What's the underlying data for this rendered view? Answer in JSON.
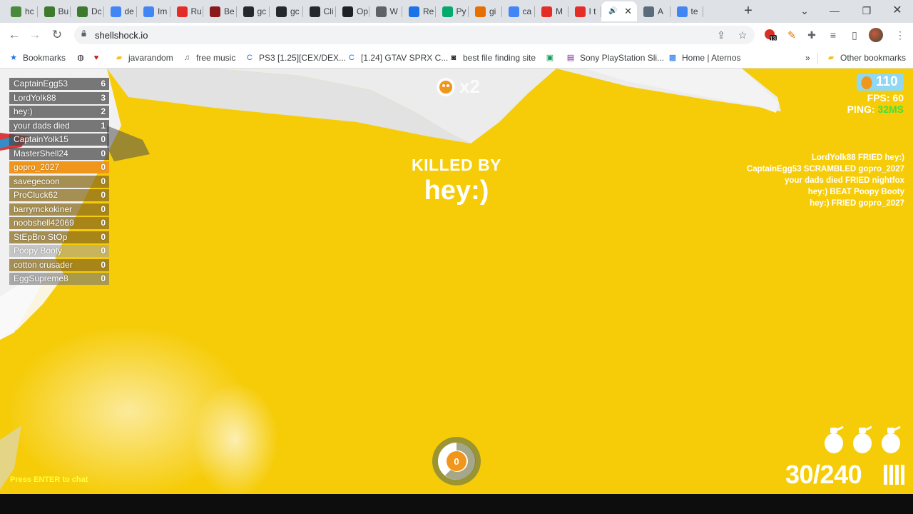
{
  "browser": {
    "tabs": [
      {
        "label": "hc",
        "icon": "google-docs-icon",
        "color": "#4a8a3c"
      },
      {
        "label": "Bu",
        "icon": "minecraft-icon",
        "color": "#3d7a2b"
      },
      {
        "label": "Dc",
        "icon": "minecraft-icon",
        "color": "#3d7a2b"
      },
      {
        "label": "de",
        "icon": "google-icon",
        "color": "#4285f4"
      },
      {
        "label": "Im",
        "icon": "chart-icon",
        "color": "#4285f4"
      },
      {
        "label": "Ru",
        "icon": "youtube-icon",
        "color": "#e52d27"
      },
      {
        "label": "Be",
        "icon": "m-logo-icon",
        "color": "#8a1a1a"
      },
      {
        "label": "gc",
        "icon": "github-icon",
        "color": "#24292e"
      },
      {
        "label": "gc",
        "icon": "github-icon",
        "color": "#24292e"
      },
      {
        "label": "Cli",
        "icon": "github-icon",
        "color": "#24292e"
      },
      {
        "label": "Op",
        "icon": "openai-icon",
        "color": "#202124"
      },
      {
        "label": "W",
        "icon": "globe-icon",
        "color": "#5f6368"
      },
      {
        "label": "Re",
        "icon": "record-icon",
        "color": "#1a73e8"
      },
      {
        "label": "Py",
        "icon": "w3-icon",
        "color": "#04aa6d"
      },
      {
        "label": "gi",
        "icon": "java-icon",
        "color": "#e76f00"
      },
      {
        "label": "ca",
        "icon": "google-icon",
        "color": "#4285f4"
      },
      {
        "label": "M",
        "icon": "youtube-icon",
        "color": "#e52d27"
      },
      {
        "label": "I t",
        "icon": "youtube-icon",
        "color": "#e52d27"
      },
      {
        "label": "",
        "icon": "speaker-icon",
        "color": "#3c4043",
        "active": true
      },
      {
        "label": "A",
        "icon": "image-icon",
        "color": "#5a6b7a"
      },
      {
        "label": "te",
        "icon": "google-icon",
        "color": "#4285f4"
      }
    ],
    "url": "shellshock.io",
    "extension_badge": "13",
    "bookmarks": [
      {
        "label": "Bookmarks",
        "icon": "star-icon"
      },
      {
        "label": "",
        "icon": "globe-icon"
      },
      {
        "label": "",
        "icon": "heart-icon"
      },
      {
        "label": "javarandom",
        "icon": "folder-icon"
      },
      {
        "label": "free music",
        "icon": "music-icon"
      },
      {
        "label": "PS3 [1.25][CEX/DEX...",
        "icon": "c-icon"
      },
      {
        "label": "[1.24] GTAV SPRX C...",
        "icon": "c-icon"
      },
      {
        "label": "best file finding site",
        "icon": "robot-icon"
      },
      {
        "label": "",
        "icon": "app-icon"
      },
      {
        "label": "Sony PlayStation Sli...",
        "icon": "bag-icon"
      },
      {
        "label": "Home | Aternos",
        "icon": "aternos-icon"
      }
    ],
    "more_bookmarks": "»",
    "other_bookmarks": "Other bookmarks"
  },
  "game": {
    "scoreboard": [
      {
        "name": "CaptainEgg53",
        "score": "6",
        "bg": "rgba(72,72,72,0.72)"
      },
      {
        "name": "LordYolk88",
        "score": "3",
        "bg": "rgba(72,72,72,0.72)"
      },
      {
        "name": "hey:)",
        "score": "2",
        "bg": "rgba(72,72,72,0.72)"
      },
      {
        "name": "your dads died",
        "score": "1",
        "bg": "rgba(72,72,72,0.72)"
      },
      {
        "name": "CaptainYolk15",
        "score": "0",
        "bg": "rgba(72,72,72,0.72)"
      },
      {
        "name": "MasterShell24",
        "score": "0",
        "bg": "rgba(72,72,72,0.72)"
      },
      {
        "name": "gopro_2027",
        "score": "0",
        "bg": "#f0961a"
      },
      {
        "name": "savegecoon",
        "score": "0",
        "bg": "rgba(140,110,30,0.75)"
      },
      {
        "name": "ProCluck62",
        "score": "0",
        "bg": "rgba(140,110,30,0.75)"
      },
      {
        "name": "barrymckokiner",
        "score": "0",
        "bg": "rgba(140,110,30,0.75)"
      },
      {
        "name": "noobshell42069",
        "score": "0",
        "bg": "rgba(140,110,30,0.75)"
      },
      {
        "name": "StEpBro StOp",
        "score": "0",
        "bg": "rgba(140,110,30,0.75)"
      },
      {
        "name": "Poopy Booty",
        "score": "0",
        "bg": "rgba(160,160,160,0.55)"
      },
      {
        "name": "cotton crusader",
        "score": "0",
        "bg": "rgba(140,110,30,0.75)"
      },
      {
        "name": "EggSupreme8",
        "score": "0",
        "bg": "rgba(120,120,120,0.6)"
      }
    ],
    "streak_text": "x2",
    "killed_by_title": "KILLED BY",
    "killer_name": "hey:)",
    "eggs": "110",
    "fps": "FPS: 60",
    "ping_label": "PING:",
    "ping_value": "32MS",
    "ping_color": "#3ee23a",
    "killfeed": [
      "LordYolk88 FRIED hey:)",
      "CaptainEgg53 SCRAMBLED gopro_2027",
      "your dads died FRIED nightfox",
      "hey:) BEAT Poopy Booty",
      "hey:) FRIED gopro_2027"
    ],
    "respawn_counter": "0",
    "ammo": "30/240",
    "grenades": 3,
    "chat_hint": "Press ENTER to chat",
    "background_color": "#f6cc08"
  }
}
